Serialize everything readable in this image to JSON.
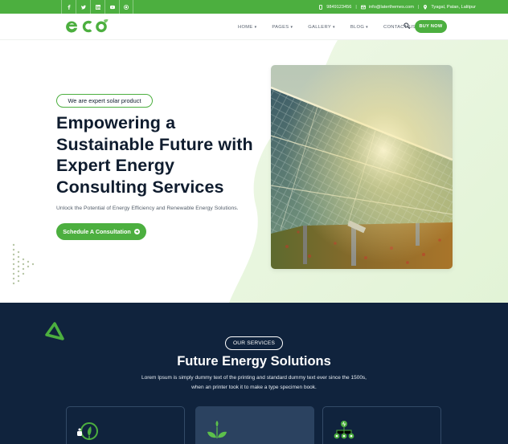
{
  "topbar": {
    "social": [
      {
        "icon": "facebook-icon",
        "glyph": "f"
      },
      {
        "icon": "twitter-icon",
        "glyph": "t"
      },
      {
        "icon": "linkedin-icon",
        "glyph": "in"
      },
      {
        "icon": "youtube-icon",
        "glyph": "yt"
      },
      {
        "icon": "instagram-icon",
        "glyph": "ig"
      }
    ],
    "phone": "9849123456",
    "email": "info@laterthemes.com",
    "address": "Tyagal, Patan, Lalitpur"
  },
  "header": {
    "logo": "eco",
    "nav": [
      {
        "label": "HOME"
      },
      {
        "label": "PAGES"
      },
      {
        "label": "GALLERY"
      },
      {
        "label": "BLOG"
      },
      {
        "label": "CONTACT US"
      }
    ],
    "buy_label": "BUY NOW"
  },
  "hero": {
    "badge": "We are expert solar product",
    "title": "Empowering a Sustainable Future with Expert Energy Consulting Services",
    "subtitle": "Unlock the Potential of Energy Efficiency and Renewable Energy Solutions.",
    "cta_label": "Schedule A Consultation"
  },
  "services": {
    "badge": "OUR SERVICES",
    "title": "Future Energy Solutions",
    "desc_line1": "Lorem Ipsum is simply dummy text of the printing and standard dummy text ever since the 1500s,",
    "desc_line2": "when an printer took it to make a type specimen book."
  },
  "colors": {
    "brand_green": "#4caf3f",
    "navy": "#10233d",
    "card_active": "#2b4260",
    "text_dark": "#0f1c2e"
  }
}
